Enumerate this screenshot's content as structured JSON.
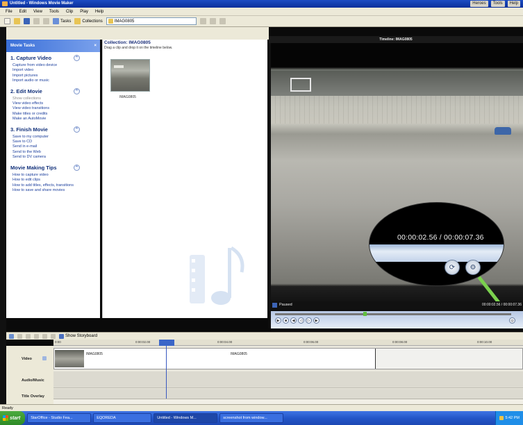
{
  "window": {
    "title": "Untitled - Windows Movie Maker",
    "right_tools": [
      "Heroes",
      "Tools",
      "Help"
    ]
  },
  "menu": [
    "File",
    "Edit",
    "View",
    "Tools",
    "Clip",
    "Play",
    "Help"
  ],
  "toolbar": {
    "tasks_label": "Tasks",
    "collections_label": "Collections",
    "collection_value": "IMAG0805"
  },
  "tasks_pane": {
    "header": "Movie Tasks",
    "close": "×",
    "sections": [
      {
        "title": "1. Capture Video",
        "links": [
          "Capture from video device",
          "Import video",
          "Import pictures",
          "Import audio or music"
        ]
      },
      {
        "title": "2. Edit Movie",
        "links": [
          "Show collections",
          "View video effects",
          "View video transitions",
          "Make titles or credits",
          "Make an AutoMovie"
        ]
      },
      {
        "title": "3. Finish Movie",
        "links": [
          "Save to my computer",
          "Save to CD",
          "Send in e-mail",
          "Send to the Web",
          "Send to DV camera"
        ]
      },
      {
        "title": "Movie Making Tips",
        "links": [
          "How to capture video",
          "How to edit clips",
          "How to add titles, effects, transitions",
          "How to save and share movies"
        ]
      }
    ]
  },
  "collection": {
    "title": "Collection: IMAG0805",
    "subtitle": "Drag a clip and drop it on the timeline below.",
    "clip_name": "IMAG0805"
  },
  "monitor": {
    "title": "Timeline: IMAG0805",
    "time_display": "00:00:02.56 / 00:00:07.36",
    "status": "Paused",
    "status_time": "00:00:02.56 / 00:00:07.36",
    "seek_position": 0.38
  },
  "timeline": {
    "show_storyboard": "Show Storyboard",
    "ticks": [
      "0:00",
      "0:00:02.00",
      "0:00:04.00",
      "0:00:06.00",
      "0:00:08.00",
      "0:00:10.00",
      "0:00:12.00"
    ],
    "tracks": {
      "video": "Video",
      "audio": "Audio/Music",
      "title": "Title Overlay"
    },
    "clips": [
      "IMAG0805",
      "IMAG0805"
    ]
  },
  "statusbar": {
    "text": "Ready"
  },
  "taskbar": {
    "start": "start",
    "tasks": [
      "StarOffice - Studio Fea...",
      "EQOREDA",
      "Untitled - Windows M...",
      "screenshot from window..."
    ],
    "tray": "5:42 PM"
  }
}
